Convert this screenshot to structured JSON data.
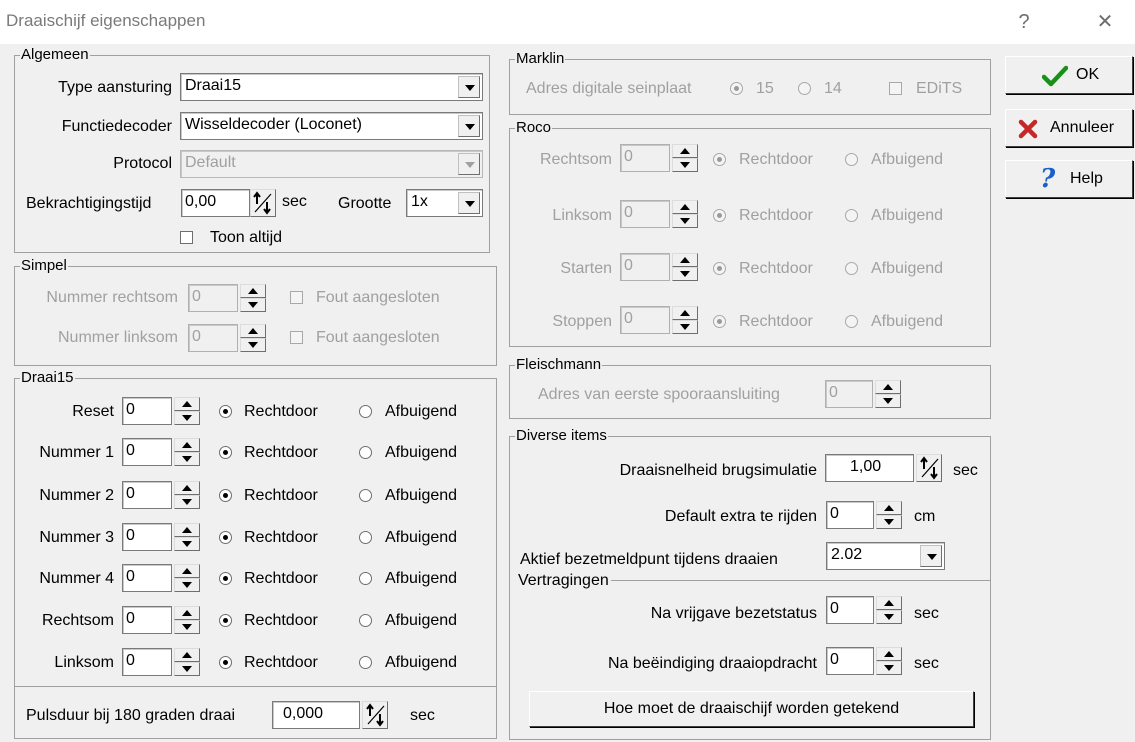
{
  "window": {
    "title": "Draaischijf eigenschappen",
    "help_glyph": "?",
    "close_glyph": "✕"
  },
  "algemeen": {
    "legend": "Algemeen",
    "type_label": "Type aansturing",
    "type_value": "Draai15",
    "functie_label": "Functiedecoder",
    "functie_value": "Wisseldecoder (Loconet)",
    "protocol_label": "Protocol",
    "protocol_value": "Default",
    "bekr_label": "Bekrachtigingstijd",
    "bekr_value": "0,00",
    "bekr_unit": "sec",
    "grootte_label": "Grootte",
    "grootte_value": "1x",
    "toon_label": "Toon altijd"
  },
  "simpel": {
    "legend": "Simpel",
    "rechtsom_label": "Nummer rechtsom",
    "rechtsom_value": "0",
    "rechtsom_fout": "Fout aangesloten",
    "linksom_label": "Nummer linksom",
    "linksom_value": "0",
    "linksom_fout": "Fout aangesloten"
  },
  "draai15": {
    "legend": "Draai15",
    "rows": [
      {
        "label": "Reset",
        "value": "0",
        "opt1": "Rechtdoor",
        "opt2": "Afbuigend"
      },
      {
        "label": "Nummer 1",
        "value": "0",
        "opt1": "Rechtdoor",
        "opt2": "Afbuigend"
      },
      {
        "label": "Nummer 2",
        "value": "0",
        "opt1": "Rechtdoor",
        "opt2": "Afbuigend"
      },
      {
        "label": "Nummer 3",
        "value": "0",
        "opt1": "Rechtdoor",
        "opt2": "Afbuigend"
      },
      {
        "label": "Nummer 4",
        "value": "0",
        "opt1": "Rechtdoor",
        "opt2": "Afbuigend"
      },
      {
        "label": "Rechtsom",
        "value": "0",
        "opt1": "Rechtdoor",
        "opt2": "Afbuigend"
      },
      {
        "label": "Linksom",
        "value": "0",
        "opt1": "Rechtdoor",
        "opt2": "Afbuigend"
      }
    ]
  },
  "puls": {
    "label": "Pulsduur bij 180 graden draai",
    "value": "0,000",
    "unit": "sec"
  },
  "marklin": {
    "legend": "Marklin",
    "adres_label": "Adres digitale seinplaat",
    "opt1": "15",
    "opt2": "14",
    "edits": "EDiTS"
  },
  "roco": {
    "legend": "Roco",
    "rows": [
      {
        "label": "Rechtsom",
        "value": "0",
        "opt1": "Rechtdoor",
        "opt2": "Afbuigend"
      },
      {
        "label": "Linksom",
        "value": "0",
        "opt1": "Rechtdoor",
        "opt2": "Afbuigend"
      },
      {
        "label": "Starten",
        "value": "0",
        "opt1": "Rechtdoor",
        "opt2": "Afbuigend"
      },
      {
        "label": "Stoppen",
        "value": "0",
        "opt1": "Rechtdoor",
        "opt2": "Afbuigend"
      }
    ]
  },
  "fleischmann": {
    "legend": "Fleischmann",
    "adres_label": "Adres van eerste spooraansluiting",
    "adres_value": "0"
  },
  "diverse": {
    "legend": "Diverse items",
    "snel_label": "Draaisnelheid brugsimulatie",
    "snel_value": "1,00",
    "snel_unit": "sec",
    "extra_label": "Default extra te rijden",
    "extra_value": "0",
    "extra_unit": "cm",
    "aktief_label": "Aktief bezetmeldpunt tijdens draaien",
    "aktief_value": "2.02",
    "vertragingen_legend": "Vertragingen",
    "vrij_label": "Na vrijgave bezetstatus",
    "vrij_value": "0",
    "vrij_unit": "sec",
    "beeind_label": "Na beëindiging draaiopdracht",
    "beeind_value": "0",
    "beeind_unit": "sec",
    "teken_button": "Hoe moet de draaischijf worden getekend"
  },
  "buttons": {
    "ok": "OK",
    "annuleer": "Annuleer",
    "help": "Help"
  },
  "colors": {
    "ok_check": "#1a8f1a",
    "cancel_x": "#c62828",
    "help_q": "#1d5fc8"
  }
}
